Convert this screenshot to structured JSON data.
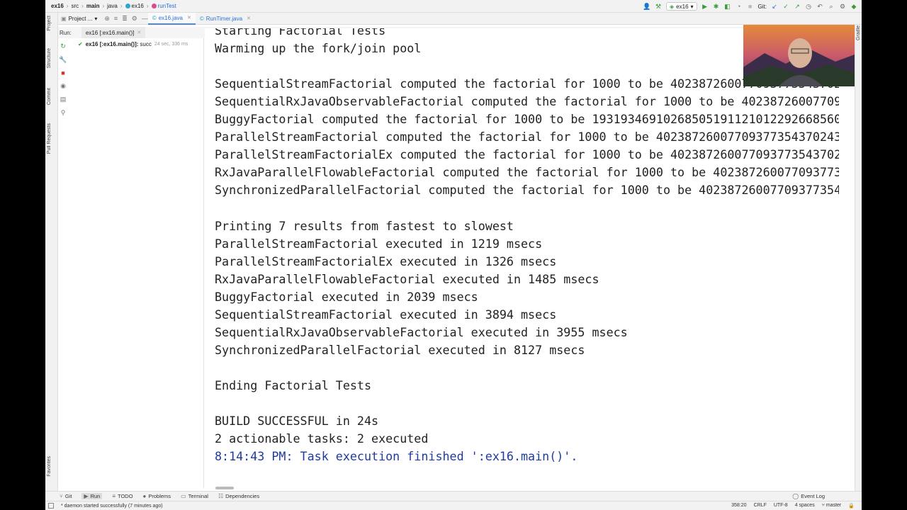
{
  "navbar": {
    "crumbs": [
      "ex16",
      "src",
      "main",
      "java",
      "ex16",
      "runTest"
    ],
    "run_config": "ex16",
    "git_label": "Git:"
  },
  "tabs": {
    "project_label": "Project ...",
    "files": [
      {
        "label": "ex16.java",
        "active": true
      },
      {
        "label": "RunTimer.java",
        "active": false
      }
    ]
  },
  "left_stripe": {
    "project": "Project",
    "structure": "Structure",
    "commit": "Commit",
    "pull_requests": "Pull Requests",
    "favorites": "Favorites"
  },
  "right_stripe": {
    "gradle": "Gradle"
  },
  "run_panel": {
    "label": "Run:",
    "tab": "ex16 [:ex16.main()]",
    "tree_item": "ex16 [:ex16.main()]:",
    "tree_item_status": "succ",
    "tree_item_time": "24 sec, 336 ms"
  },
  "console": {
    "lines": [
      {
        "text": "Starting Factorial Tests",
        "kind": "normal"
      },
      {
        "text": "Warming up the fork/join pool",
        "kind": "normal"
      },
      {
        "text": "",
        "kind": "normal"
      },
      {
        "text": "SequentialStreamFactorial computed the factorial for 1000 to be 40238726007709377354370243",
        "kind": "normal"
      },
      {
        "text": "SequentialRxJavaObservableFactorial computed the factorial for 1000 to be 40238726007709",
        "kind": "normal"
      },
      {
        "text": "BuggyFactorial computed the factorial for 1000 to be 19319346910268505191121012292668560",
        "kind": "normal"
      },
      {
        "text": "ParallelStreamFactorial computed the factorial for 1000 to be 40238726007709377354370243",
        "kind": "normal"
      },
      {
        "text": "ParallelStreamFactorialEx computed the factorial for 1000 to be 40238726007709377354370243",
        "kind": "normal"
      },
      {
        "text": "RxJavaParallelFlowableFactorial computed the factorial for 1000 to be 402387260077093773",
        "kind": "normal"
      },
      {
        "text": "SynchronizedParallelFactorial computed the factorial for 1000 to be 4023872600770937735437",
        "kind": "normal"
      },
      {
        "text": "",
        "kind": "normal"
      },
      {
        "text": "Printing 7 results from fastest to slowest",
        "kind": "normal"
      },
      {
        "text": "ParallelStreamFactorial executed in 1219 msecs",
        "kind": "normal"
      },
      {
        "text": "ParallelStreamFactorialEx executed in 1326 msecs",
        "kind": "normal"
      },
      {
        "text": "RxJavaParallelFlowableFactorial executed in 1485 msecs",
        "kind": "normal"
      },
      {
        "text": "BuggyFactorial executed in 2039 msecs",
        "kind": "normal"
      },
      {
        "text": "SequentialStreamFactorial executed in 3894 msecs",
        "kind": "normal"
      },
      {
        "text": "SequentialRxJavaObservableFactorial executed in 3955 msecs",
        "kind": "normal"
      },
      {
        "text": "SynchronizedParallelFactorial executed in 8127 msecs",
        "kind": "normal"
      },
      {
        "text": "",
        "kind": "normal"
      },
      {
        "text": "Ending Factorial Tests",
        "kind": "normal"
      },
      {
        "text": "",
        "kind": "normal"
      },
      {
        "text": "BUILD SUCCESSFUL in 24s",
        "kind": "normal"
      },
      {
        "text": "2 actionable tasks: 2 executed",
        "kind": "normal"
      },
      {
        "text": "8:14:43 PM: Task execution finished ':ex16.main()'.",
        "kind": "timeline"
      }
    ]
  },
  "bottom_tools": {
    "git": "Git",
    "run": "Run",
    "todo": "TODO",
    "problems": "Problems",
    "terminal": "Terminal",
    "dependencies": "Dependencies",
    "event_log": "Event Log"
  },
  "status": {
    "message": "* daemon started successfully (7 minutes ago)",
    "position": "358:20",
    "line_sep": "CRLF",
    "encoding": "UTF-8",
    "indent": "4 spaces",
    "branch": "master"
  },
  "colors": {
    "accent": "#4a86e8",
    "success": "#3c9a3c",
    "console_link": "#1e3c9c",
    "stop_red": "#d9302c"
  }
}
